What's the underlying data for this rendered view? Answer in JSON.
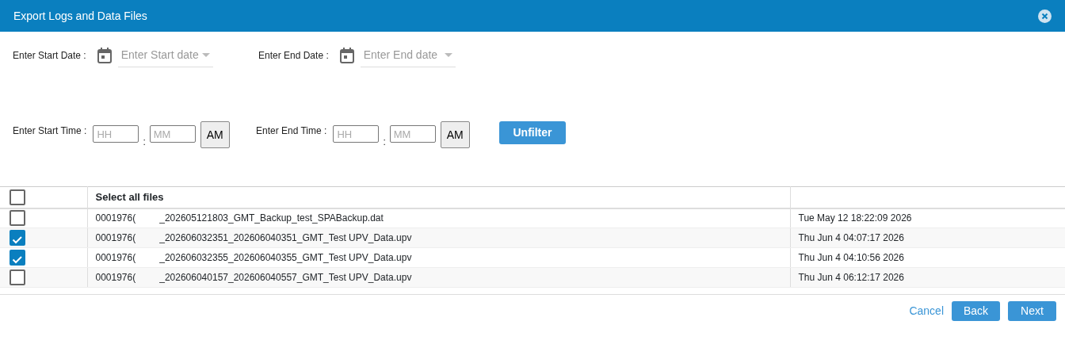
{
  "window": {
    "title": "Export Logs and Data Files"
  },
  "date_filters": [
    {
      "label": "Enter Start Date :",
      "placeholder": "Enter Start date"
    },
    {
      "label": "Enter End Date :",
      "placeholder": "Enter End date"
    }
  ],
  "time_filters": [
    {
      "label": "Enter Start Time :",
      "hour_placeholder": "HH",
      "separator": ":",
      "minute_placeholder": "MM",
      "meridiem": "AM"
    },
    {
      "label": "Enter End Time :",
      "hour_placeholder": "HH",
      "separator": ":",
      "minute_placeholder": "MM",
      "meridiem": "AM"
    }
  ],
  "unfilter_button": "Unfilter",
  "table": {
    "select_all": {
      "label": "Select all files",
      "checked": false
    },
    "rows": [
      {
        "checked": false,
        "name_start": "0001976(",
        "name_end": "_202605121803_GMT_Backup_test_SPABackup.dat",
        "date": "Tue May 12 18:22:09 2026"
      },
      {
        "checked": true,
        "name_start": "0001976(",
        "name_end": "_202606032351_202606040351_GMT_Test UPV_Data.upv",
        "date": "Thu Jun 4 04:07:17 2026"
      },
      {
        "checked": true,
        "name_start": "0001976(",
        "name_end": "_202606032355_202606040355_GMT_Test UPV_Data.upv",
        "date": "Thu Jun 4 04:10:56 2026"
      },
      {
        "checked": false,
        "name_start": "0001976(",
        "name_end": "_202606040157_202606040557_GMT_Test UPV_Data.upv",
        "date": "Thu Jun 4 06:12:17 2026"
      }
    ]
  },
  "footer": {
    "cancel": "Cancel",
    "back": "Back",
    "next": "Next"
  }
}
